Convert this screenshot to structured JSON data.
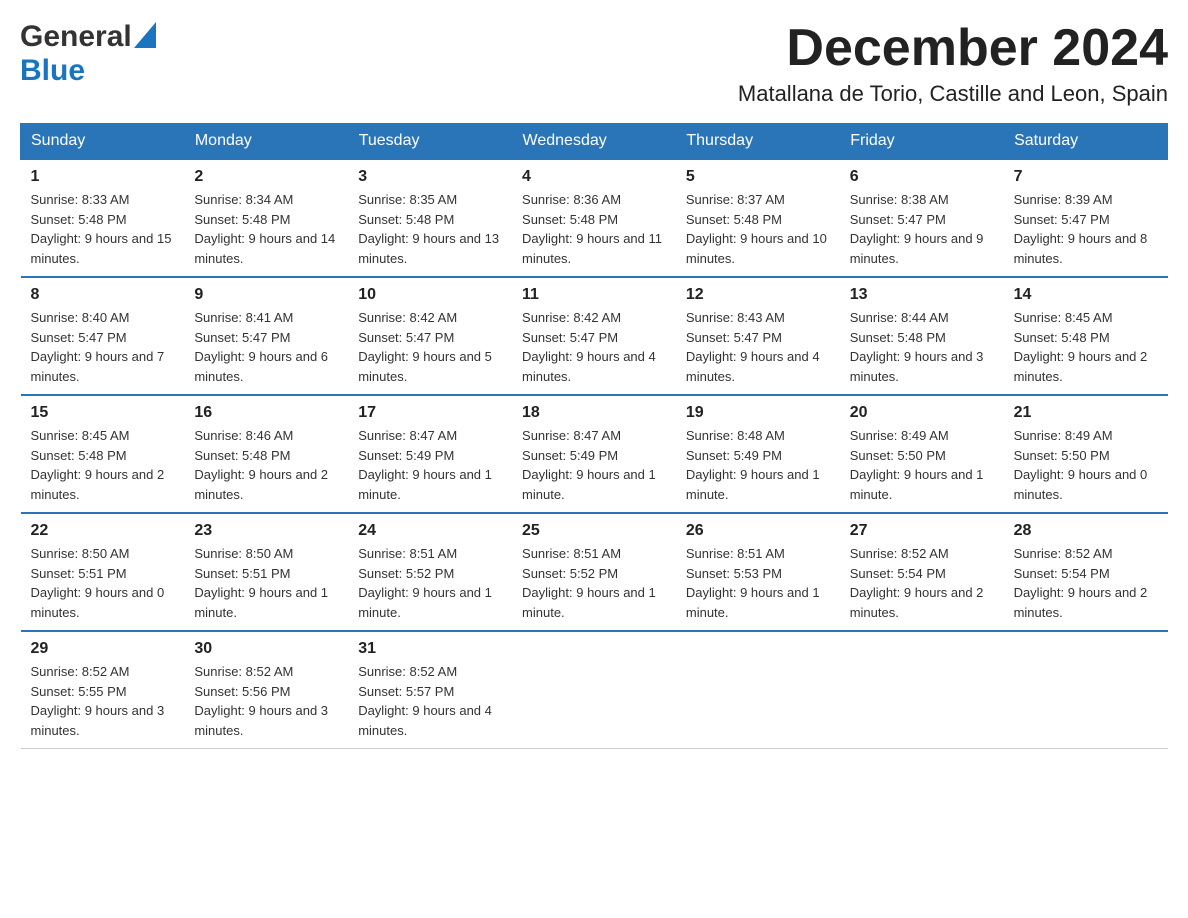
{
  "logo": {
    "general": "General",
    "blue": "Blue"
  },
  "title": "December 2024",
  "subtitle": "Matallana de Torio, Castille and Leon, Spain",
  "days_of_week": [
    "Sunday",
    "Monday",
    "Tuesday",
    "Wednesday",
    "Thursday",
    "Friday",
    "Saturday"
  ],
  "weeks": [
    [
      {
        "day": "1",
        "sunrise": "8:33 AM",
        "sunset": "5:48 PM",
        "daylight": "9 hours and 15 minutes."
      },
      {
        "day": "2",
        "sunrise": "8:34 AM",
        "sunset": "5:48 PM",
        "daylight": "9 hours and 14 minutes."
      },
      {
        "day": "3",
        "sunrise": "8:35 AM",
        "sunset": "5:48 PM",
        "daylight": "9 hours and 13 minutes."
      },
      {
        "day": "4",
        "sunrise": "8:36 AM",
        "sunset": "5:48 PM",
        "daylight": "9 hours and 11 minutes."
      },
      {
        "day": "5",
        "sunrise": "8:37 AM",
        "sunset": "5:48 PM",
        "daylight": "9 hours and 10 minutes."
      },
      {
        "day": "6",
        "sunrise": "8:38 AM",
        "sunset": "5:47 PM",
        "daylight": "9 hours and 9 minutes."
      },
      {
        "day": "7",
        "sunrise": "8:39 AM",
        "sunset": "5:47 PM",
        "daylight": "9 hours and 8 minutes."
      }
    ],
    [
      {
        "day": "8",
        "sunrise": "8:40 AM",
        "sunset": "5:47 PM",
        "daylight": "9 hours and 7 minutes."
      },
      {
        "day": "9",
        "sunrise": "8:41 AM",
        "sunset": "5:47 PM",
        "daylight": "9 hours and 6 minutes."
      },
      {
        "day": "10",
        "sunrise": "8:42 AM",
        "sunset": "5:47 PM",
        "daylight": "9 hours and 5 minutes."
      },
      {
        "day": "11",
        "sunrise": "8:42 AM",
        "sunset": "5:47 PM",
        "daylight": "9 hours and 4 minutes."
      },
      {
        "day": "12",
        "sunrise": "8:43 AM",
        "sunset": "5:47 PM",
        "daylight": "9 hours and 4 minutes."
      },
      {
        "day": "13",
        "sunrise": "8:44 AM",
        "sunset": "5:48 PM",
        "daylight": "9 hours and 3 minutes."
      },
      {
        "day": "14",
        "sunrise": "8:45 AM",
        "sunset": "5:48 PM",
        "daylight": "9 hours and 2 minutes."
      }
    ],
    [
      {
        "day": "15",
        "sunrise": "8:45 AM",
        "sunset": "5:48 PM",
        "daylight": "9 hours and 2 minutes."
      },
      {
        "day": "16",
        "sunrise": "8:46 AM",
        "sunset": "5:48 PM",
        "daylight": "9 hours and 2 minutes."
      },
      {
        "day": "17",
        "sunrise": "8:47 AM",
        "sunset": "5:49 PM",
        "daylight": "9 hours and 1 minute."
      },
      {
        "day": "18",
        "sunrise": "8:47 AM",
        "sunset": "5:49 PM",
        "daylight": "9 hours and 1 minute."
      },
      {
        "day": "19",
        "sunrise": "8:48 AM",
        "sunset": "5:49 PM",
        "daylight": "9 hours and 1 minute."
      },
      {
        "day": "20",
        "sunrise": "8:49 AM",
        "sunset": "5:50 PM",
        "daylight": "9 hours and 1 minute."
      },
      {
        "day": "21",
        "sunrise": "8:49 AM",
        "sunset": "5:50 PM",
        "daylight": "9 hours and 0 minutes."
      }
    ],
    [
      {
        "day": "22",
        "sunrise": "8:50 AM",
        "sunset": "5:51 PM",
        "daylight": "9 hours and 0 minutes."
      },
      {
        "day": "23",
        "sunrise": "8:50 AM",
        "sunset": "5:51 PM",
        "daylight": "9 hours and 1 minute."
      },
      {
        "day": "24",
        "sunrise": "8:51 AM",
        "sunset": "5:52 PM",
        "daylight": "9 hours and 1 minute."
      },
      {
        "day": "25",
        "sunrise": "8:51 AM",
        "sunset": "5:52 PM",
        "daylight": "9 hours and 1 minute."
      },
      {
        "day": "26",
        "sunrise": "8:51 AM",
        "sunset": "5:53 PM",
        "daylight": "9 hours and 1 minute."
      },
      {
        "day": "27",
        "sunrise": "8:52 AM",
        "sunset": "5:54 PM",
        "daylight": "9 hours and 2 minutes."
      },
      {
        "day": "28",
        "sunrise": "8:52 AM",
        "sunset": "5:54 PM",
        "daylight": "9 hours and 2 minutes."
      }
    ],
    [
      {
        "day": "29",
        "sunrise": "8:52 AM",
        "sunset": "5:55 PM",
        "daylight": "9 hours and 3 minutes."
      },
      {
        "day": "30",
        "sunrise": "8:52 AM",
        "sunset": "5:56 PM",
        "daylight": "9 hours and 3 minutes."
      },
      {
        "day": "31",
        "sunrise": "8:52 AM",
        "sunset": "5:57 PM",
        "daylight": "9 hours and 4 minutes."
      },
      null,
      null,
      null,
      null
    ]
  ],
  "labels": {
    "sunrise": "Sunrise:",
    "sunset": "Sunset:",
    "daylight": "Daylight:"
  },
  "colors": {
    "header_bg": "#2a75b8",
    "border_top": "#2a75b8"
  }
}
